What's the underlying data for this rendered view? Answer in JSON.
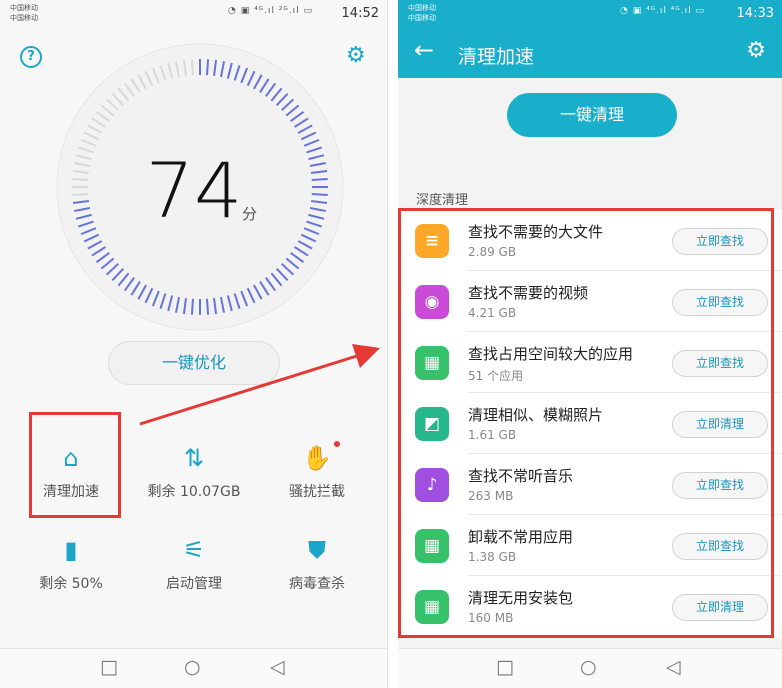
{
  "left": {
    "status": {
      "carrier1": "中国移动",
      "carrier2": "中国移动",
      "icons": "◔ ▣ ⁴ᴳ.ıl ²ᴳ.ıl ▭",
      "time": "14:52"
    },
    "help_icon": "?",
    "score": {
      "value": "74",
      "unit": "分"
    },
    "optimize_label": "一键优化",
    "tools": [
      {
        "icon": "broom-icon",
        "glyph": "⌂",
        "label": "清理加速"
      },
      {
        "icon": "storage-icon",
        "glyph": "⇅",
        "label": "剩余 10.07GB"
      },
      {
        "icon": "harassment-block-icon",
        "glyph": "✋",
        "label": "骚扰拦截"
      },
      {
        "icon": "battery-icon",
        "glyph": "▮",
        "label": "剩余 50%"
      },
      {
        "icon": "startup-manage-icon",
        "glyph": "⚟",
        "label": "启动管理"
      },
      {
        "icon": "virus-scan-icon",
        "glyph": "⛊",
        "label": "病毒查杀"
      }
    ],
    "gauge": {
      "score_fraction": 0.74
    }
  },
  "right": {
    "status": {
      "carrier1": "中国移动",
      "carrier2": "中国移动",
      "icons": "◔ ▣ ⁴ᴳ.ıl ⁴ᴳ.ıl ▭",
      "time": "14:33"
    },
    "title": "清理加速",
    "clean_label": "一键清理",
    "section_label": "深度清理",
    "items": [
      {
        "icon": "document-icon",
        "color": "#ffa726",
        "glyph": "≡",
        "title": "查找不需要的大文件",
        "sub": "2.89 GB",
        "button": "立即查找"
      },
      {
        "icon": "video-icon",
        "color": "#c94bd8",
        "glyph": "◉",
        "title": "查找不需要的视频",
        "sub": "4.21 GB",
        "button": "立即查找"
      },
      {
        "icon": "apps-icon",
        "color": "#37c16b",
        "glyph": "▦",
        "title": "查找占用空间较大的应用",
        "sub": "51 个应用",
        "button": "立即查找"
      },
      {
        "icon": "photo-icon",
        "color": "#26b88a",
        "glyph": "◩",
        "title": "清理相似、模糊照片",
        "sub": "1.61 GB",
        "button": "立即清理"
      },
      {
        "icon": "music-icon",
        "color": "#a14fe0",
        "glyph": "♪",
        "title": "查找不常听音乐",
        "sub": "263 MB",
        "button": "立即查找"
      },
      {
        "icon": "uninstall-apps-icon",
        "color": "#37c16b",
        "glyph": "▦",
        "title": "卸载不常用应用",
        "sub": "1.38 GB",
        "button": "立即查找"
      },
      {
        "icon": "install-package-icon",
        "color": "#37c16b",
        "glyph": "▦",
        "title": "清理无用安装包",
        "sub": "160 MB",
        "button": "立即清理"
      }
    ]
  },
  "nav": {
    "back": "□",
    "home": "○",
    "recent": "◁"
  },
  "colors": {
    "accent": "#19aec9",
    "highlight": "#e53935",
    "gauge_active": "#6673d9",
    "gauge_inactive": "#d9d9d9"
  }
}
